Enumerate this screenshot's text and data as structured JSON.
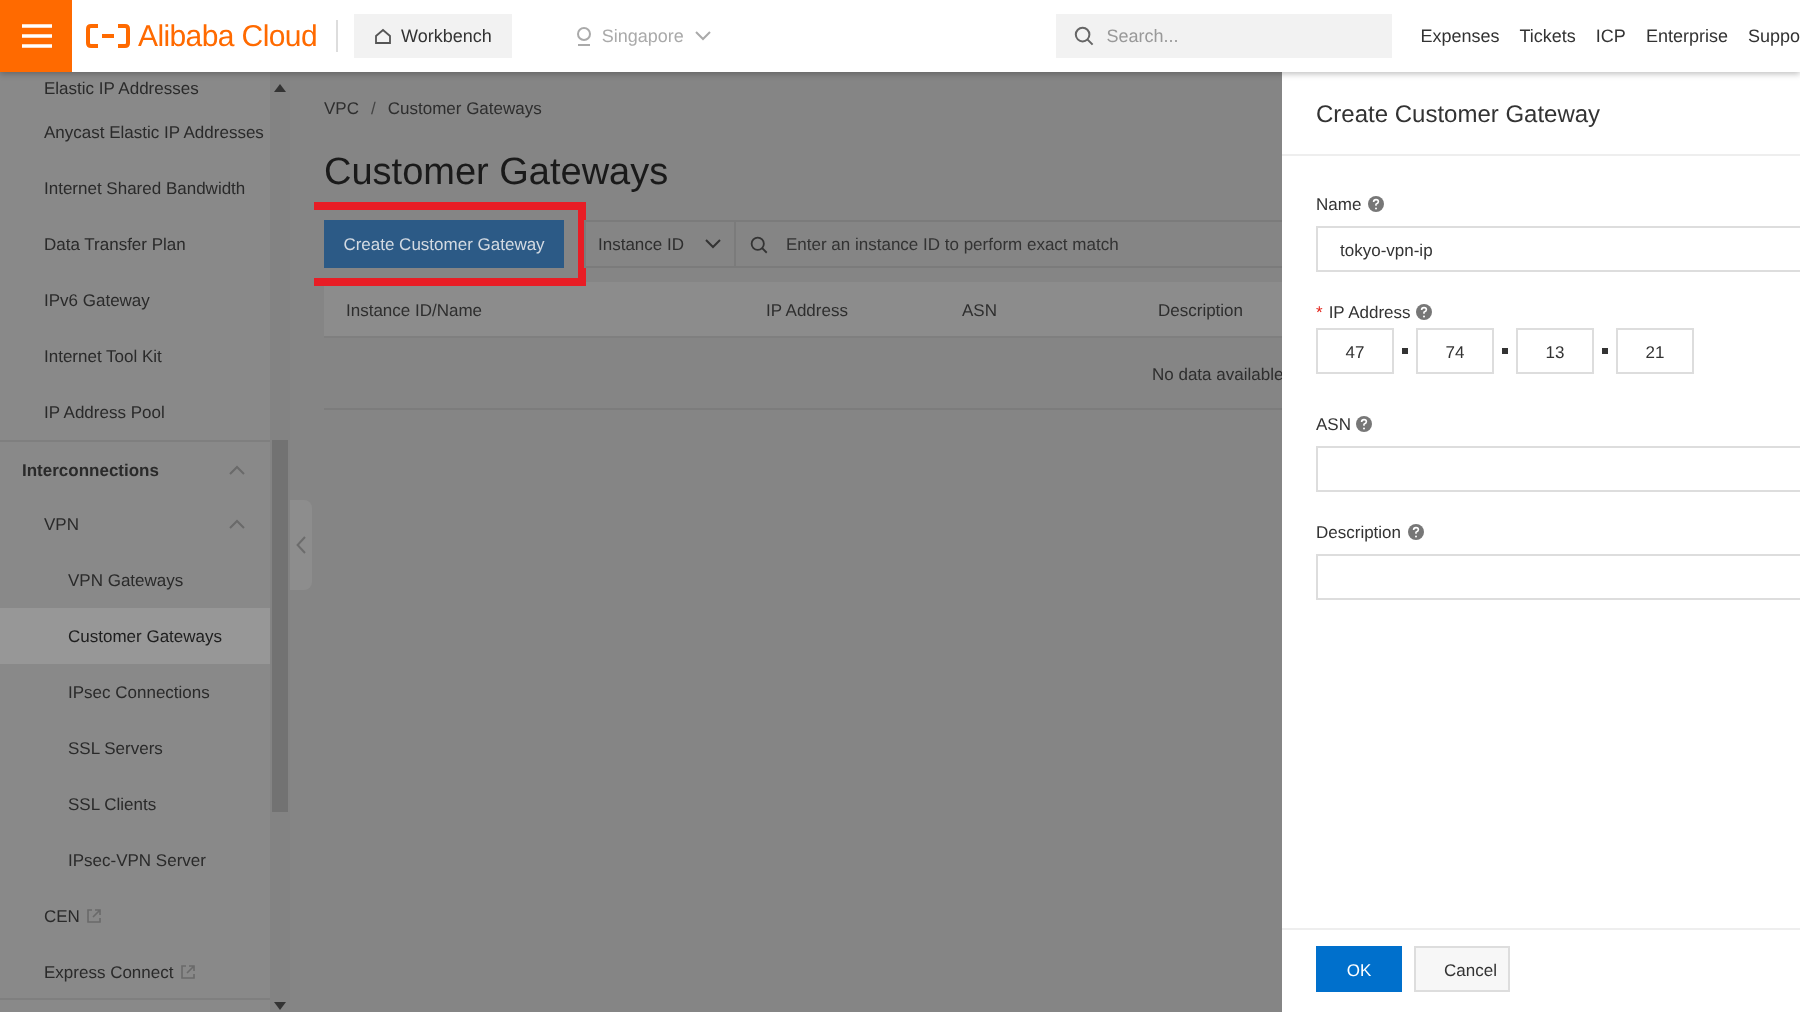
{
  "topbar": {
    "brand": "Alibaba Cloud",
    "workbench": "Workbench",
    "region": "Singapore",
    "search": {
      "placeholder": "Search..."
    },
    "links": [
      "Expenses",
      "Tickets",
      "ICP",
      "Enterprise",
      "Suppo"
    ]
  },
  "sidebar": {
    "items": [
      {
        "label": "Elastic IP Addresses",
        "selected": false
      },
      {
        "label": "Anycast Elastic IP Addresses",
        "selected": false
      },
      {
        "label": "Internet Shared Bandwidth",
        "selected": false
      },
      {
        "label": "Data Transfer Plan",
        "selected": false
      },
      {
        "label": "IPv6 Gateway",
        "selected": false
      },
      {
        "label": "Internet Tool Kit",
        "selected": false
      },
      {
        "label": "IP Address Pool",
        "selected": false
      }
    ],
    "sections": [
      {
        "label": "Interconnections",
        "expanded": true,
        "children": [
          {
            "label": "VPN",
            "expanded": true,
            "children": [
              {
                "label": "VPN Gateways",
                "selected": false
              },
              {
                "label": "Customer Gateways",
                "selected": true
              },
              {
                "label": "IPsec Connections",
                "selected": false
              },
              {
                "label": "SSL Servers",
                "selected": false
              },
              {
                "label": "SSL Clients",
                "selected": false
              },
              {
                "label": "IPsec-VPN Server",
                "selected": false
              }
            ]
          },
          {
            "label": "CEN",
            "external": true,
            "selected": false
          },
          {
            "label": "Express Connect",
            "external": true,
            "selected": false
          }
        ]
      }
    ]
  },
  "page": {
    "breadcrumb": [
      "VPC",
      "Customer Gateways"
    ],
    "breadcrumb_separator": "/",
    "title": "Customer Gateways",
    "toolbar": {
      "create_button": {
        "label": "Create Customer Gateway",
        "highlighted": true
      },
      "filter": "Instance ID",
      "search": {
        "placeholder": "Enter an instance ID to perform exact match"
      }
    },
    "table": {
      "columns": [
        "Instance ID/Name",
        "IP Address",
        "ASN",
        "Description"
      ],
      "empty_text": "No data available"
    }
  },
  "drawer": {
    "title": "Create Customer Gateway",
    "fields": [
      {
        "kind": "text",
        "label": "Name",
        "value": "tokyo-vpn-ip"
      },
      {
        "kind": "ip",
        "label": "IP Address",
        "required_mark": "*",
        "octets": [
          "47",
          "74",
          "13",
          "21"
        ]
      },
      {
        "kind": "text",
        "label": "ASN"
      },
      {
        "kind": "text",
        "label": "Description"
      }
    ],
    "buttons": [
      {
        "label": "OK",
        "kind": "primary"
      },
      {
        "label": "Cancel",
        "kind": "secondary"
      }
    ]
  }
}
